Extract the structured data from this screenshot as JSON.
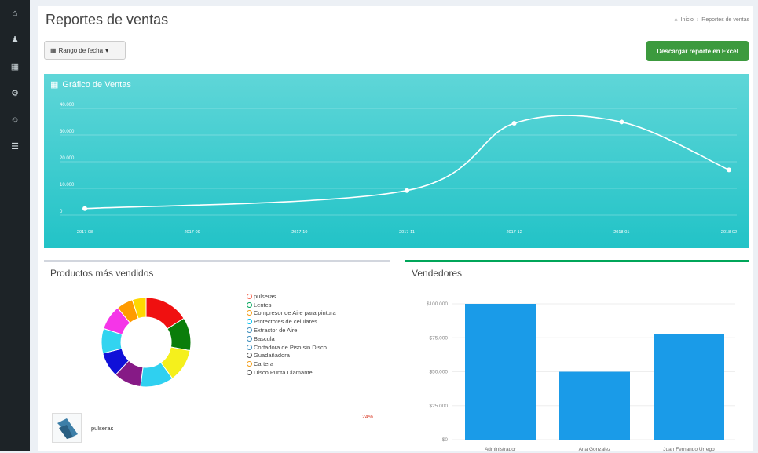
{
  "nav": {
    "icons": [
      {
        "name": "home-icon",
        "glyph": "⌂"
      },
      {
        "name": "user-icon",
        "glyph": "♟"
      },
      {
        "name": "grid-icon",
        "glyph": "▦"
      },
      {
        "name": "settings-icon",
        "glyph": "⚙"
      },
      {
        "name": "users-icon",
        "glyph": "☺"
      },
      {
        "name": "list-icon",
        "glyph": "☰"
      }
    ]
  },
  "header": {
    "title": "Reportes de ventas",
    "breadcrumb": [
      "Inicio",
      "Reportes de ventas"
    ]
  },
  "toolbar": {
    "range_label": "Rango de fecha",
    "excel_label": "Descargar reporte en Excel"
  },
  "sales_chart": {
    "title": "Gráfico de Ventas",
    "chart_data": {
      "type": "line",
      "x": [
        "2017-08",
        "2017-09",
        "2017-10",
        "2017-11",
        "2017-12",
        "2018-01",
        "2018-02"
      ],
      "point_x": [
        "2017-08",
        "2017-11",
        "2017-12",
        "2018-01",
        "2018-02"
      ],
      "point_y": [
        1000,
        3800,
        14200,
        14400,
        7000
      ],
      "yticks": [
        "0",
        "10.000",
        "20.000",
        "30.000",
        "40.000"
      ],
      "ylim": [
        0,
        17000
      ],
      "grid": true
    }
  },
  "products": {
    "title": "Productos más vendidos",
    "chart_data": {
      "type": "pie",
      "labels": [
        "pulseras",
        "Lentes",
        "Compresor de Aire para pintura",
        "Protectores de celulares",
        "Extractor de Aire",
        "Bascula",
        "Cortadora de Piso sin Disco",
        "Guadañadora",
        "Cartera",
        "Disco Punta Diamante"
      ],
      "values": [
        16,
        12,
        12,
        12,
        10,
        9,
        9,
        9,
        6,
        5
      ],
      "colors": [
        "#f01010",
        "#0a7d0a",
        "#f5f01c",
        "#2fd0f0",
        "#861a86",
        "#1010d8",
        "#32d4f0",
        "#f535e8",
        "#ff9b00",
        "#ffd700"
      ],
      "legend_colors": [
        "#f56954",
        "#00a65a",
        "#f39c12",
        "#00c0ef",
        "#3c8dbc",
        "#3c8dbc",
        "#3c8dbc",
        "#555555",
        "#f39c12",
        "#555555"
      ]
    },
    "top_item": {
      "name": "pulseras",
      "percent": "24%"
    }
  },
  "sellers": {
    "title": "Vendedores",
    "chart_data": {
      "type": "bar",
      "categories": [
        "Administrador",
        "Ana Gonzalez",
        "Juan Fernando Urrego"
      ],
      "values": [
        100000,
        50000,
        78000
      ],
      "yticks": [
        "$0",
        "$25.000",
        "$50.000",
        "$75.000",
        "$100.000"
      ],
      "ylim": [
        0,
        100000
      ],
      "color": "#1a9be8"
    }
  }
}
